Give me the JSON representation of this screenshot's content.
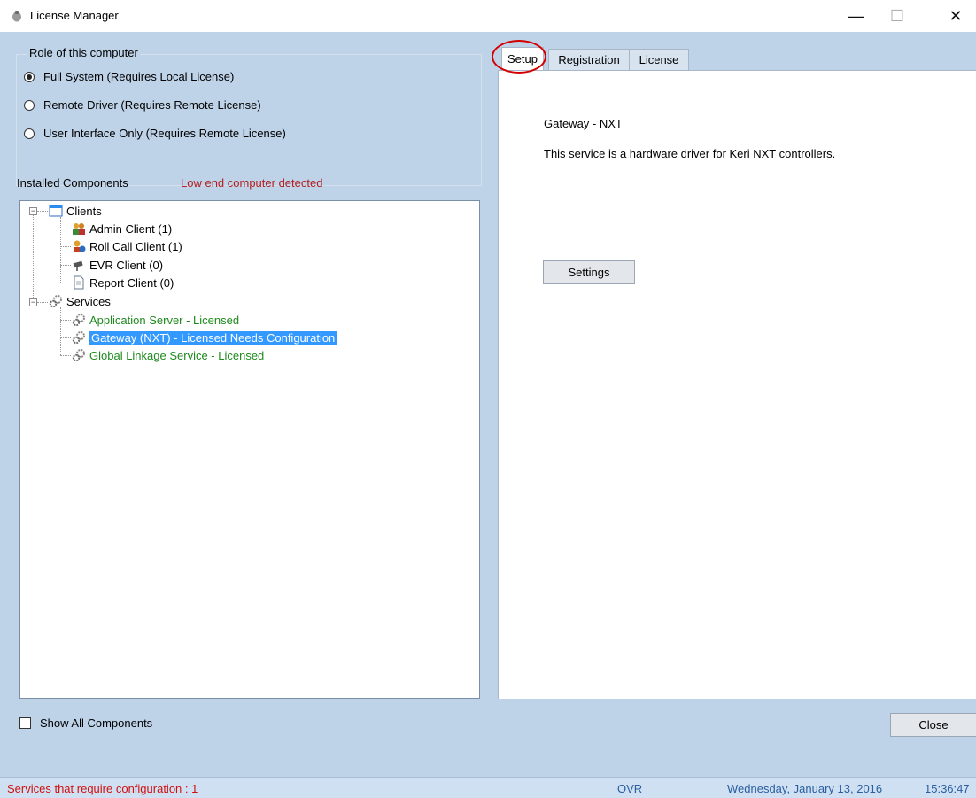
{
  "window": {
    "title": "License Manager",
    "minimize": "—",
    "maximize": "☐",
    "close": "✕"
  },
  "role": {
    "title": "Role of this computer",
    "options": [
      {
        "label": "Full System (Requires Local License)",
        "checked": true
      },
      {
        "label": "Remote Driver (Requires Remote License)",
        "checked": false
      },
      {
        "label": "User Interface Only (Requires Remote License)",
        "checked": false
      }
    ]
  },
  "components": {
    "label": "Installed Components",
    "warning": "Low end computer detected",
    "warning_color": "#b02020",
    "tree": {
      "clients_label": "Clients",
      "clients": [
        "Admin Client (1)",
        "Roll Call Client (1)",
        "EVR Client (0)",
        "Report Client (0)"
      ],
      "services_label": "Services",
      "services": [
        "Application Server - Licensed",
        "Gateway (NXT) - Licensed Needs Configuration",
        "Global Linkage Service - Licensed"
      ],
      "selected_service": 1,
      "licensed_color": "#1e8a1e",
      "selection_color": "#3399ff"
    },
    "show_all_label": "Show All Components"
  },
  "tabs": [
    "Setup",
    "Registration",
    "License"
  ],
  "active_tab": "Setup",
  "setup": {
    "service_name": "Gateway - NXT",
    "description": "This service is a hardware driver for Keri NXT controllers.",
    "settings_button": "Settings"
  },
  "close_button": "Close",
  "status": {
    "message": "Services that require configuration : 1",
    "mode": "OVR",
    "date": "Wednesday, January 13, 2016",
    "time": "15:36:47"
  }
}
